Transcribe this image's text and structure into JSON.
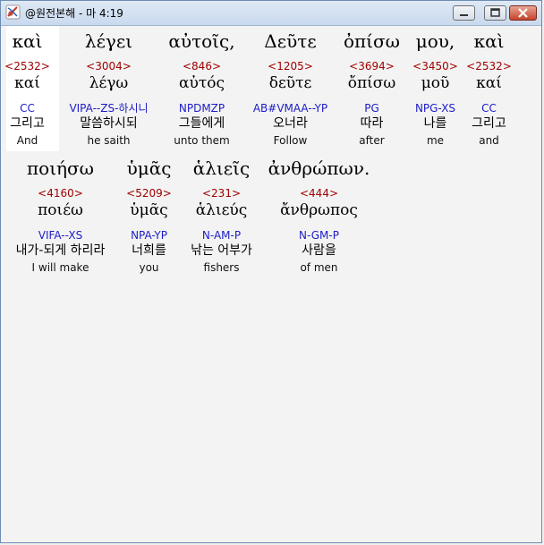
{
  "window": {
    "title": "@원전본해 - 마 4:19"
  },
  "lines": [
    {
      "words": [
        {
          "greek": "καὶ",
          "strong": "<2532>",
          "lemma": "καί",
          "parse": "CC",
          "korean": "그리고",
          "english": "And"
        },
        {
          "greek": "λέγει",
          "strong": "<3004>",
          "lemma": "λέγω",
          "parse": "VIPA--ZS-하시니",
          "korean": "말씀하시되",
          "english": "he saith"
        },
        {
          "greek": "αὐτοῖς,",
          "strong": "<846>",
          "lemma": "αὐτός",
          "parse": "NPDMZP",
          "korean": "그들에게",
          "english": "unto them"
        },
        {
          "greek": "Δεῦτε",
          "strong": "<1205>",
          "lemma": "δεῦτε",
          "parse": "AB#VMAA--YP",
          "korean": "오너라",
          "english": "Follow"
        },
        {
          "greek": "ὀπίσω",
          "strong": "<3694>",
          "lemma": "ὄπίσω",
          "parse": "PG",
          "korean": "따라",
          "english": "after"
        },
        {
          "greek": "μου,",
          "strong": "<3450>",
          "lemma": "μοῦ",
          "parse": "NPG-XS",
          "korean": "나를",
          "english": "me"
        },
        {
          "greek": "καὶ",
          "strong": "<2532>",
          "lemma": "καί",
          "parse": "CC",
          "korean": "그리고",
          "english": "and"
        }
      ]
    },
    {
      "words": [
        {
          "greek": "ποιήσω",
          "strong": "<4160>",
          "lemma": "ποιέω",
          "parse": "VIFA--XS",
          "korean": "내가-되게 하리라",
          "english": "I will make"
        },
        {
          "greek": "ὑμᾶς",
          "strong": "<5209>",
          "lemma": "ὑμᾶς",
          "parse": "NPA-YP",
          "korean": "너희를",
          "english": "you"
        },
        {
          "greek": "ἁλιεῖς",
          "strong": "<231>",
          "lemma": "ἁλιεύς",
          "parse": "N-AM-P",
          "korean": "낚는 어부가",
          "english": "fishers"
        },
        {
          "greek": "ἀνθρώπων.",
          "strong": "<444>",
          "lemma": "ἄνθρωπος",
          "parse": "N-GM-P",
          "korean": "사람을",
          "english": "of men"
        }
      ]
    }
  ]
}
